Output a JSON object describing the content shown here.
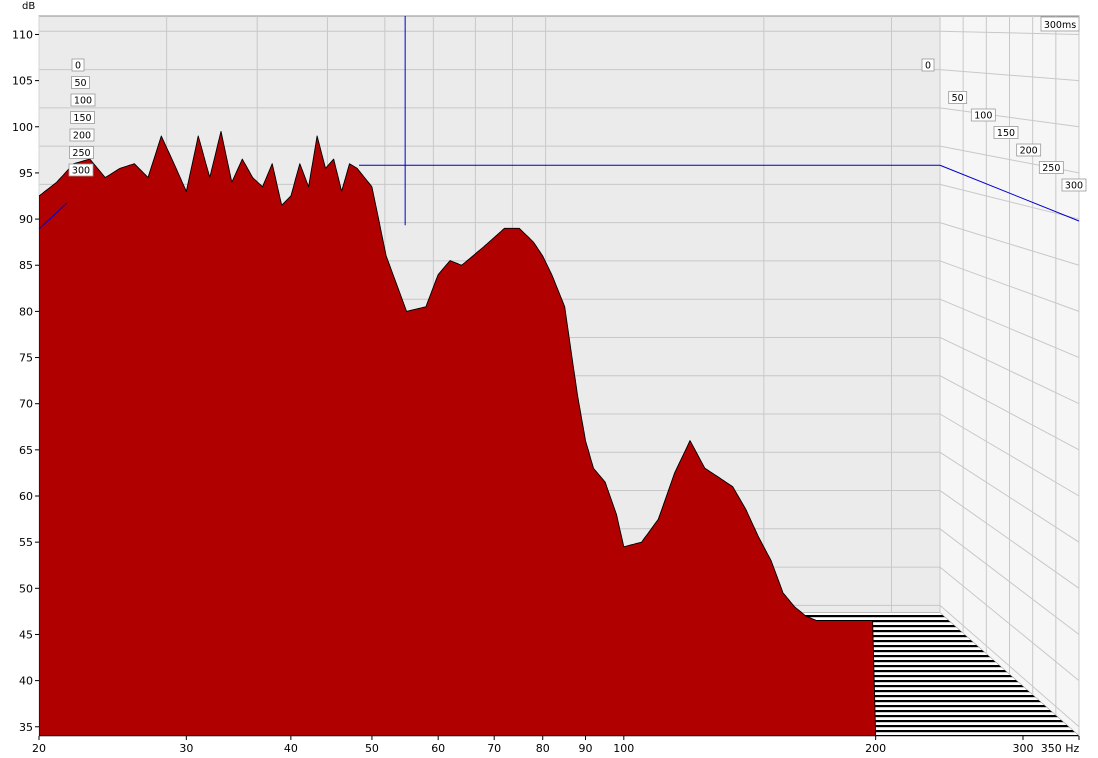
{
  "chart_data": {
    "type": "area",
    "subtype": "waterfall",
    "xlabel": "Hz",
    "ylabel": "dB",
    "x_scale": "log",
    "xlim": [
      20,
      350
    ],
    "ylim": [
      34,
      112
    ],
    "x_ticks": [
      20,
      30,
      40,
      50,
      60,
      70,
      80,
      90,
      100,
      200,
      300,
      350
    ],
    "x_tick_labels": [
      "20",
      "30",
      "40",
      "50",
      "60",
      "70",
      "80",
      "90",
      "100",
      "200",
      "300",
      "350 Hz"
    ],
    "y_ticks": [
      35,
      40,
      45,
      50,
      55,
      60,
      65,
      70,
      75,
      80,
      85,
      90,
      95,
      100,
      105,
      110
    ],
    "time_range_label": "300ms",
    "time_labels": [
      "0",
      "50",
      "100",
      "150",
      "200",
      "250",
      "300"
    ],
    "time_values_ms": [
      0,
      50,
      100,
      150,
      200,
      250,
      300
    ],
    "cursor": {
      "frequency_hz": 64,
      "level_db": 92.5
    },
    "grid": true,
    "colors": {
      "fill": "#b00000",
      "outline": "#000000",
      "background": "#ebebeb",
      "grid": "#c8c8c8",
      "cursor": "#0000cc"
    },
    "front_slice": {
      "time_ms": 0,
      "x": [
        20,
        21,
        22,
        23,
        24,
        25,
        26,
        27,
        28,
        29,
        30,
        31,
        32,
        33,
        34,
        35,
        36,
        37,
        38,
        39,
        40,
        41,
        42,
        43,
        44,
        45,
        46,
        47,
        48,
        50,
        52,
        55,
        58,
        60,
        62,
        64,
        66,
        68,
        70,
        72,
        75,
        78,
        80,
        82,
        85,
        88,
        90,
        92,
        95,
        98,
        100,
        105,
        110,
        115,
        120,
        125,
        130,
        135,
        140,
        145,
        150,
        155,
        160,
        165,
        170,
        175,
        180,
        185,
        190,
        200
      ],
      "y": [
        92.5,
        94.0,
        96.0,
        96.5,
        94.5,
        95.5,
        96.0,
        94.5,
        99.0,
        96.0,
        93.0,
        99.0,
        94.5,
        99.5,
        94.0,
        96.5,
        94.5,
        93.5,
        96.0,
        91.5,
        92.5,
        96.0,
        93.5,
        99.0,
        95.5,
        96.5,
        93.0,
        96.0,
        95.5,
        93.5,
        86.0,
        80.0,
        80.5,
        84.0,
        85.5,
        85.0,
        86.0,
        87.0,
        88.0,
        89.0,
        89.0,
        87.5,
        86.0,
        84.0,
        80.5,
        71.0,
        66.0,
        63.0,
        61.5,
        58.0,
        54.5,
        55.0,
        57.5,
        62.5,
        66.0,
        63.0,
        62.0,
        61.0,
        58.5,
        55.5,
        53.0,
        49.5,
        48.0,
        47.0,
        46.5,
        46.5,
        46.5,
        46.5,
        46.5,
        46.5
      ]
    }
  }
}
